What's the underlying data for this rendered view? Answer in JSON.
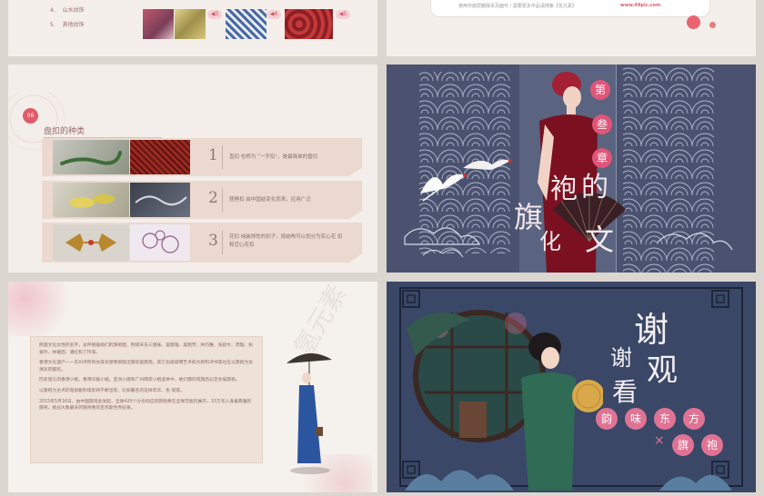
{
  "top_left": {
    "items": [
      {
        "num": "4.",
        "label": "山水纹饰"
      },
      {
        "num": "5.",
        "label": "其他纹饰"
      }
    ],
    "badges": [
      "3",
      "4",
      "5"
    ]
  },
  "top_right": {
    "notice": "使用中底层删除本页面可 / 需要更多作品请搜索【氢元素】",
    "link": "www.49pic.com"
  },
  "mid_left": {
    "section_num": "06",
    "section_title": "盘扣的种类",
    "rows": [
      {
        "num": "1",
        "text": "直扣 也称为 “一字扣”，是最简单的盘扣"
      },
      {
        "num": "2",
        "text": "琵琶扣 由中国结变化而来，应用广泛"
      },
      {
        "num": "3",
        "text": "花扣 纯装饰性的扣子，按结构可以划分为实心花 扣和空心花扣"
      }
    ]
  },
  "mid_right": {
    "chapter_chars": [
      "第",
      "叁",
      "章"
    ],
    "title_chars": [
      "旗",
      "袍",
      "的",
      "文",
      "化"
    ]
  },
  "bot_left": {
    "watermark": "氢元素",
    "paragraphs": [
      "民国文化女性的名字，总伴随着她们的旗袍图，例如宋氏三姐妹、吴健雄、吴贻芳、林巧稚、张舒文、周璇、张爱玲、林徽因、潘红和丁玲等。",
      "香港文化遗产——东州评所的女就员想像版版出旗装是旗袍。其它也续续明艺术如大新和评书等也在以旗袍为女演员的服装。",
      "历史悠久的香港小姐，香港华裔小姐，亚洲小姐和广州两岸小姐选举中，她们都问或旗后必定会穿旗袍。",
      "以旗袍为主点的电视剧和电影将不断出现，比如著名的花样年华、色 戒等。",
      "2015年5月16日，由中国旗袍会发起，全球420个分会响应的旗袍秀在全球范围内展开，15万华人身着典雅的旗袍，挑战大数最多的旗袍秀的吉尼斯世界纪录。"
    ]
  },
  "bot_right": {
    "big_chars": [
      "谢",
      "谢",
      "观",
      "看"
    ],
    "row1": [
      "韵",
      "味",
      "东",
      "方"
    ],
    "cross": "×",
    "row2": [
      "旗",
      "袍"
    ]
  },
  "colors": {
    "accent": "#e05a66",
    "brown": "#9c6b6b",
    "navy": "#4a5270"
  }
}
